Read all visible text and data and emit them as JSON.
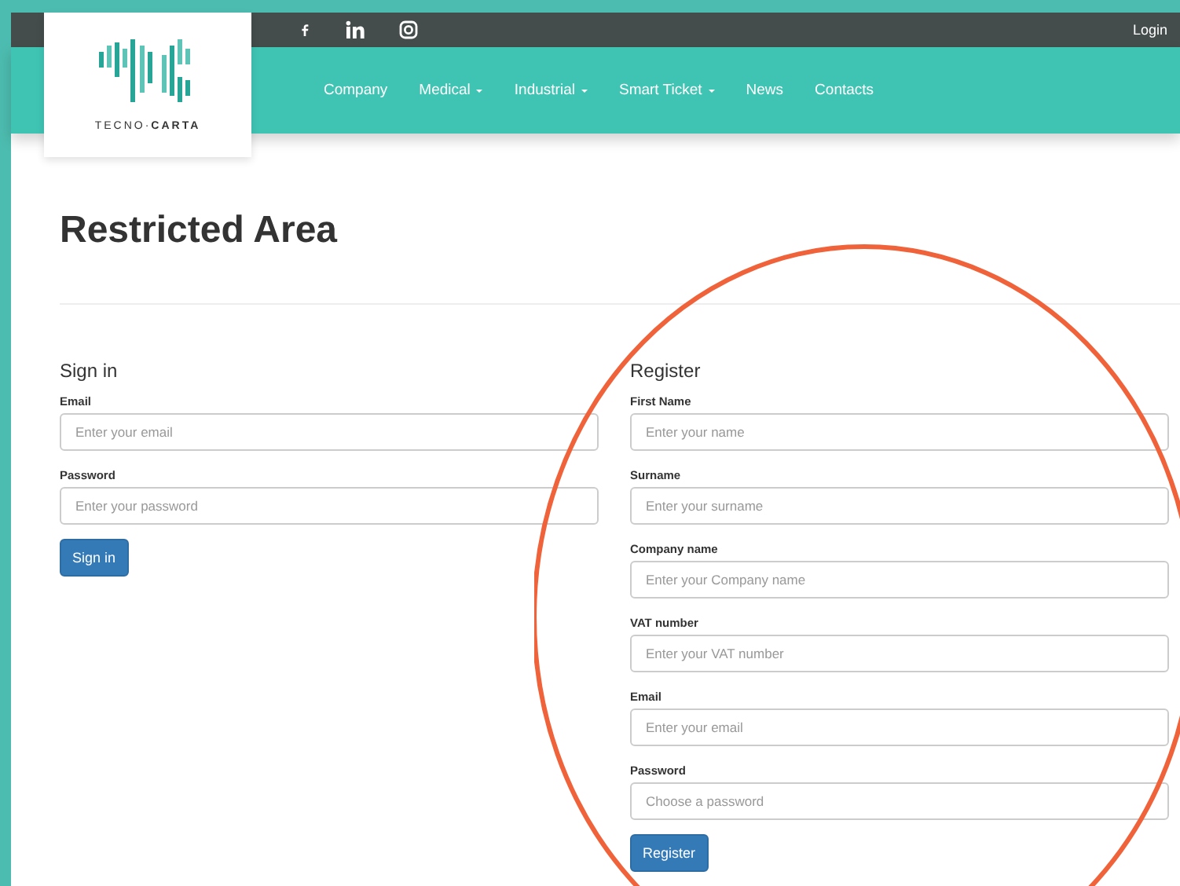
{
  "logo": {
    "text": "TECNO·**CARTA**"
  },
  "topbar": {
    "social": [
      {
        "kind": "facebook"
      },
      {
        "kind": "linkedin"
      },
      {
        "kind": "instagram"
      }
    ],
    "login": "Login"
  },
  "nav": [
    {
      "label": "Company",
      "dropdown": false
    },
    {
      "label": "Medical",
      "dropdown": true
    },
    {
      "label": "Industrial",
      "dropdown": true
    },
    {
      "label": "Smart Ticket",
      "dropdown": true
    },
    {
      "label": "News",
      "dropdown": false
    },
    {
      "label": "Contacts",
      "dropdown": false
    }
  ],
  "title": "Restricted Area",
  "sign_in": {
    "heading": "Sign in",
    "fields": [
      {
        "label": "Email",
        "placeholder": "Enter your email"
      },
      {
        "label": "Password",
        "placeholder": "Enter your password"
      }
    ],
    "button": "Sign in"
  },
  "register": {
    "heading": "Register",
    "fields": [
      {
        "label": "First Name",
        "placeholder": "Enter your name"
      },
      {
        "label": "Surname",
        "placeholder": "Enter your surname"
      },
      {
        "label": "Company name",
        "placeholder": "Enter your Company name"
      },
      {
        "label": "VAT number",
        "placeholder": "Enter your VAT number"
      },
      {
        "label": "Email",
        "placeholder": "Enter your email"
      },
      {
        "label": "Password",
        "placeholder": "Choose a password"
      }
    ],
    "button": "Register"
  }
}
